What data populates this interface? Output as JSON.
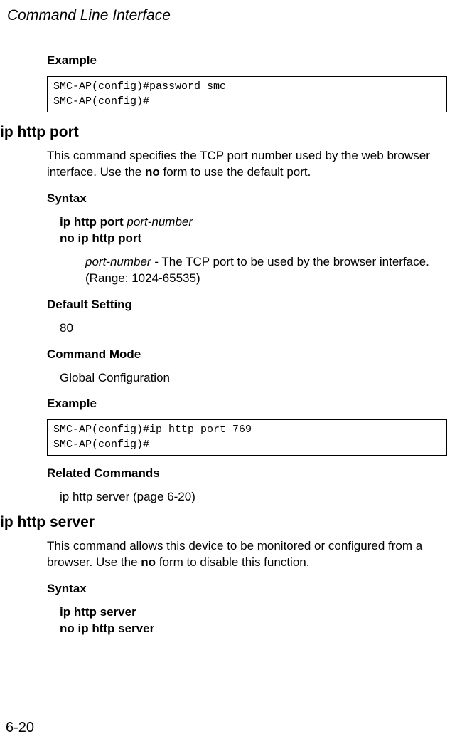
{
  "running_header": "Command Line Interface",
  "section1": {
    "example_heading": "Example",
    "code_line1": "SMC-AP(config)#password smc",
    "code_line2": "SMC-AP(config)#"
  },
  "cmd1": {
    "title": "ip http port",
    "desc_pre": "This command specifies the TCP port number used by the web browser interface. Use the ",
    "desc_bold": "no",
    "desc_post": " form to use the default port.",
    "syntax_heading": "Syntax",
    "syntax_cmd": "ip http port ",
    "syntax_arg": "port-number",
    "syntax_line2": "no ip http port",
    "param_arg": "port-number",
    "param_text": " - The TCP port to be used by the browser interface. (Range: 1024-65535)",
    "default_heading": "Default Setting",
    "default_value": "80",
    "mode_heading": "Command Mode",
    "mode_value": "Global Configuration",
    "example_heading": "Example",
    "code_line1": "SMC-AP(config)#ip http port 769",
    "code_line2": "SMC-AP(config)#",
    "related_heading": "Related Commands",
    "related_value": "ip http server (page 6-20)"
  },
  "cmd2": {
    "title": "ip http server",
    "desc_pre": "This command allows this device to be monitored or configured from a browser. Use the ",
    "desc_bold": "no",
    "desc_post": " form to disable this function.",
    "syntax_heading": "Syntax",
    "syntax_line1": "ip http server",
    "syntax_line2": "no ip http server"
  },
  "page_number": "6-20"
}
